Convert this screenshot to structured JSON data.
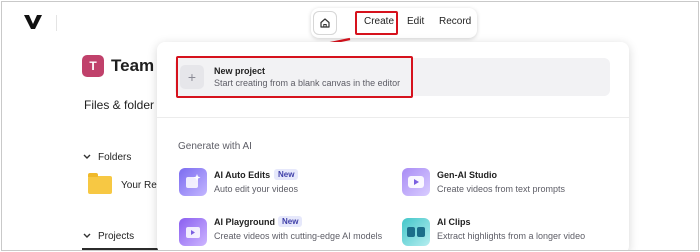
{
  "topbar": {
    "logo_icon": "vimeo-v-logo",
    "home_icon": "home-icon",
    "nav": [
      "Create",
      "Edit",
      "Record"
    ],
    "active": "Create"
  },
  "background_page": {
    "team_initial": "T",
    "team_title": "Team",
    "files_title": "Files & folder",
    "folders_label": "Folders",
    "folder_item": "Your Re",
    "projects_label": "Projects"
  },
  "menu": {
    "new_project": {
      "title": "New project",
      "desc": "Start creating from a blank canvas in the editor"
    },
    "section_title": "Generate with AI",
    "tools": [
      {
        "title": "AI Auto Edits",
        "badge": "New",
        "desc": "Auto edit your videos"
      },
      {
        "title": "Gen-AI Studio",
        "badge": "",
        "desc": "Create videos from text prompts"
      },
      {
        "title": "AI Playground",
        "badge": "New",
        "desc": "Create videos with cutting-edge AI models"
      },
      {
        "title": "AI Clips",
        "badge": "",
        "desc": "Extract highlights from a longer video"
      }
    ]
  },
  "colors": {
    "highlight": "#d6121d",
    "team_avatar": "#c0416b",
    "badge_bg": "#e6e8fb",
    "folder": "#f7c843"
  }
}
